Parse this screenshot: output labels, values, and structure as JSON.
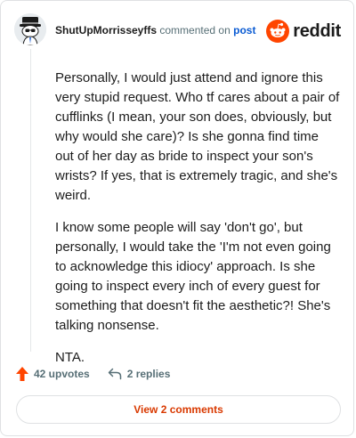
{
  "comment": {
    "username": "ShutUpMorrisseyffs",
    "action_text": "commented on",
    "post_link": "post",
    "brand": "reddit",
    "paragraphs": [
      "Personally, I would just attend and ignore this very stupid request. Who tf cares about a pair of cufflinks (I mean, your son does, obviously, but why would she care)? Is she gonna find time out of her day as bride to inspect your son's wrists? If yes, that is extremely tragic, and she's weird.",
      "I know some people will say 'don't go', but personally, I would take the 'I'm not even going to acknowledge this idiocy' approach. Is she going to inspect every inch of every guest for something that doesn't fit the aesthetic?! She's talking nonsense.",
      "NTA."
    ]
  },
  "footer": {
    "upvotes": "42 upvotes",
    "replies": "2 replies",
    "view_comments": "View 2 comments"
  },
  "icons": {
    "avatar": "snoo-avatar-icon",
    "brand": "reddit-logo-icon",
    "upvote": "upvote-arrow-icon",
    "reply": "reply-arrow-icon"
  },
  "colors": {
    "brand": "#ff4500",
    "link": "#0a5bd3",
    "view_comments": "#d93900",
    "upvote": "#ff4500"
  }
}
